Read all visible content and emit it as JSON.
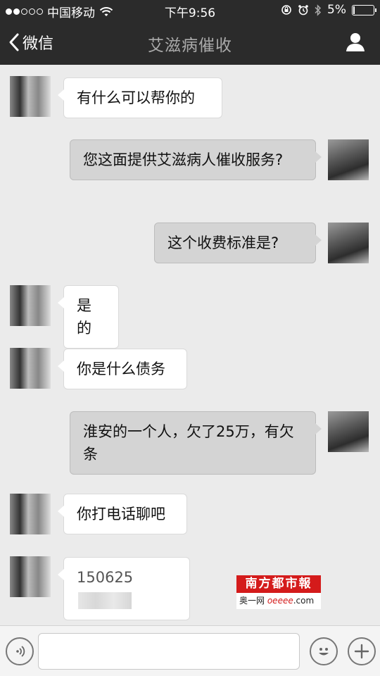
{
  "status_bar": {
    "carrier": "中国移动",
    "time": "下午9:56",
    "battery_text": "5%",
    "battery_level": 0.05,
    "icons": [
      "signal-dots-icon",
      "wifi-icon",
      "orientation-lock-icon",
      "alarm-icon",
      "bluetooth-icon",
      "battery-icon"
    ]
  },
  "nav": {
    "back_label": "微信",
    "title": "艾滋病催收",
    "profile_icon": "person-icon"
  },
  "messages": [
    {
      "side": "them",
      "text": "有什么可以帮你的"
    },
    {
      "side": "me",
      "text": "您这面提供艾滋病人催收服务?"
    },
    {
      "side": "me",
      "text": "这个收费标准是?"
    },
    {
      "side": "them",
      "text": "是的"
    },
    {
      "side": "them",
      "text": "你是什么债务"
    },
    {
      "side": "me",
      "text": "淮安的一个人，欠了25万，有欠条"
    },
    {
      "side": "them",
      "text": "你打电话聊吧"
    },
    {
      "side": "them",
      "text": "150625",
      "redacted": true
    }
  ],
  "watermark": {
    "title": "南方都市報",
    "line1": "奥一网",
    "line2": "oeeee",
    "line3": ".com"
  },
  "input_bar": {
    "voice_icon": "voice-icon",
    "emoji_icon": "emoji-icon",
    "plus_icon": "plus-icon",
    "input_value": ""
  },
  "colors": {
    "bar_bg": "#2b2b2b",
    "chat_bg": "#ebebeb",
    "bubble_them": "#ffffff",
    "bubble_me": "#d4d4d4",
    "watermark_red": "#d41b1b"
  }
}
